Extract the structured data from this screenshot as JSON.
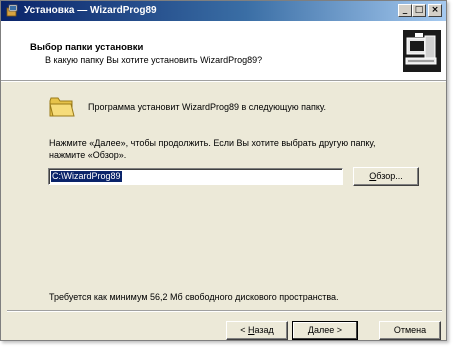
{
  "window": {
    "title": "Установка — WizardProg89",
    "controls": {
      "minimize_icon": "minimize-icon",
      "maximize_icon": "maximize-icon",
      "close_icon": "close-icon"
    }
  },
  "header": {
    "title": "Выбор папки установки",
    "subtitle": "В какую папку Вы хотите установить WizardProg89?",
    "logo_icon": "setup-computer-icon"
  },
  "body": {
    "folder_icon": "folder-icon",
    "intro": "Программа установит WizardProg89 в следующую папку.",
    "instruction_line1": "Нажмите «Далее», чтобы продолжить. Если Вы хотите выбрать другую папку,",
    "instruction_line2": "нажмите «Обзор».",
    "path_value": "C:\\WizardProg89",
    "browse_accel": "О",
    "browse_rest": "бзор...",
    "free_space": "Требуется как минимум 56,2 Мб свободного дискового пространства."
  },
  "footer": {
    "back_prefix": "< ",
    "back_accel": "Н",
    "back_rest": "азад",
    "next_accel": "Д",
    "next_rest": "алее >",
    "cancel_label": "Отмена"
  },
  "colors": {
    "titlebar_start": "#0a246a",
    "titlebar_end": "#a6caf0",
    "dialog_bg": "#ece9d8",
    "selection": "#0a246a"
  }
}
